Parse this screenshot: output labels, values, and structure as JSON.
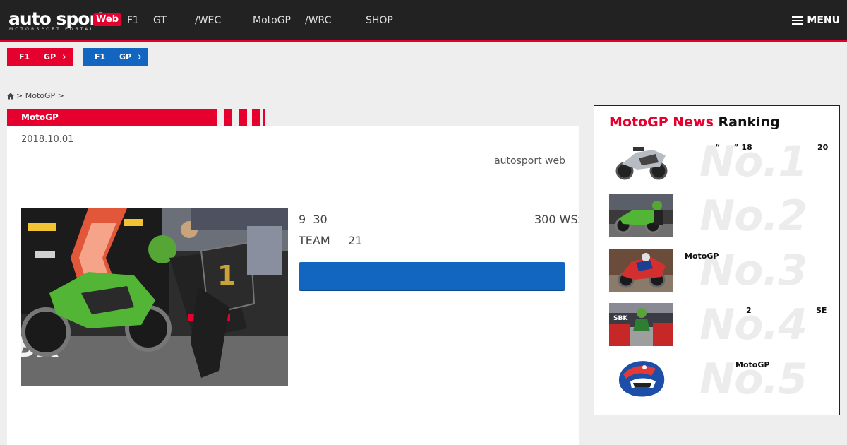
{
  "header": {
    "logo_main": "auto sport",
    "logo_badge": "Web",
    "logo_sub": "MOTORSPORT PORTAL",
    "nav": [
      "F1",
      "GT",
      "/WEC",
      "MotoGP",
      "/WRC",
      "SHOP"
    ],
    "menu_label": "MENU",
    "menu_icon": "hamburger-icon"
  },
  "gp_buttons": [
    {
      "part1": "F1",
      "part2": "GP",
      "chevron": "›",
      "color": "#e5002d"
    },
    {
      "part1": "F1",
      "part2": "GP",
      "chevron": "›",
      "color": "#1366c0"
    }
  ],
  "breadcrumb": {
    "home_icon": "home-icon",
    "sep1": ">",
    "item": "MotoGP",
    "sep2": ">"
  },
  "category": "MotoGP",
  "article": {
    "date": "2018.10.01",
    "author": "autosport web",
    "lead_line1_a": "9  30",
    "lead_line1_b": "300  WSS",
    "lead_line2": "TEAM     21"
  },
  "ranking": {
    "title_red": "MotoGP News",
    "title_black": "Ranking",
    "items": [
      {
        "num": "No.1",
        "text_a": "“     ” 18",
        "text_b": "20"
      },
      {
        "num": "No.2",
        "text_a": "",
        "text_b": ""
      },
      {
        "num": "No.3",
        "text_a": "MotoGP",
        "text_b": ""
      },
      {
        "num": "No.4",
        "text_a": "2",
        "text_b": "SE"
      },
      {
        "num": "No.5",
        "text_a": "MotoGP",
        "text_b": ""
      }
    ]
  },
  "colors": {
    "brand_red": "#e5002d",
    "brand_blue": "#1366c0",
    "header_bg": "#222222"
  }
}
